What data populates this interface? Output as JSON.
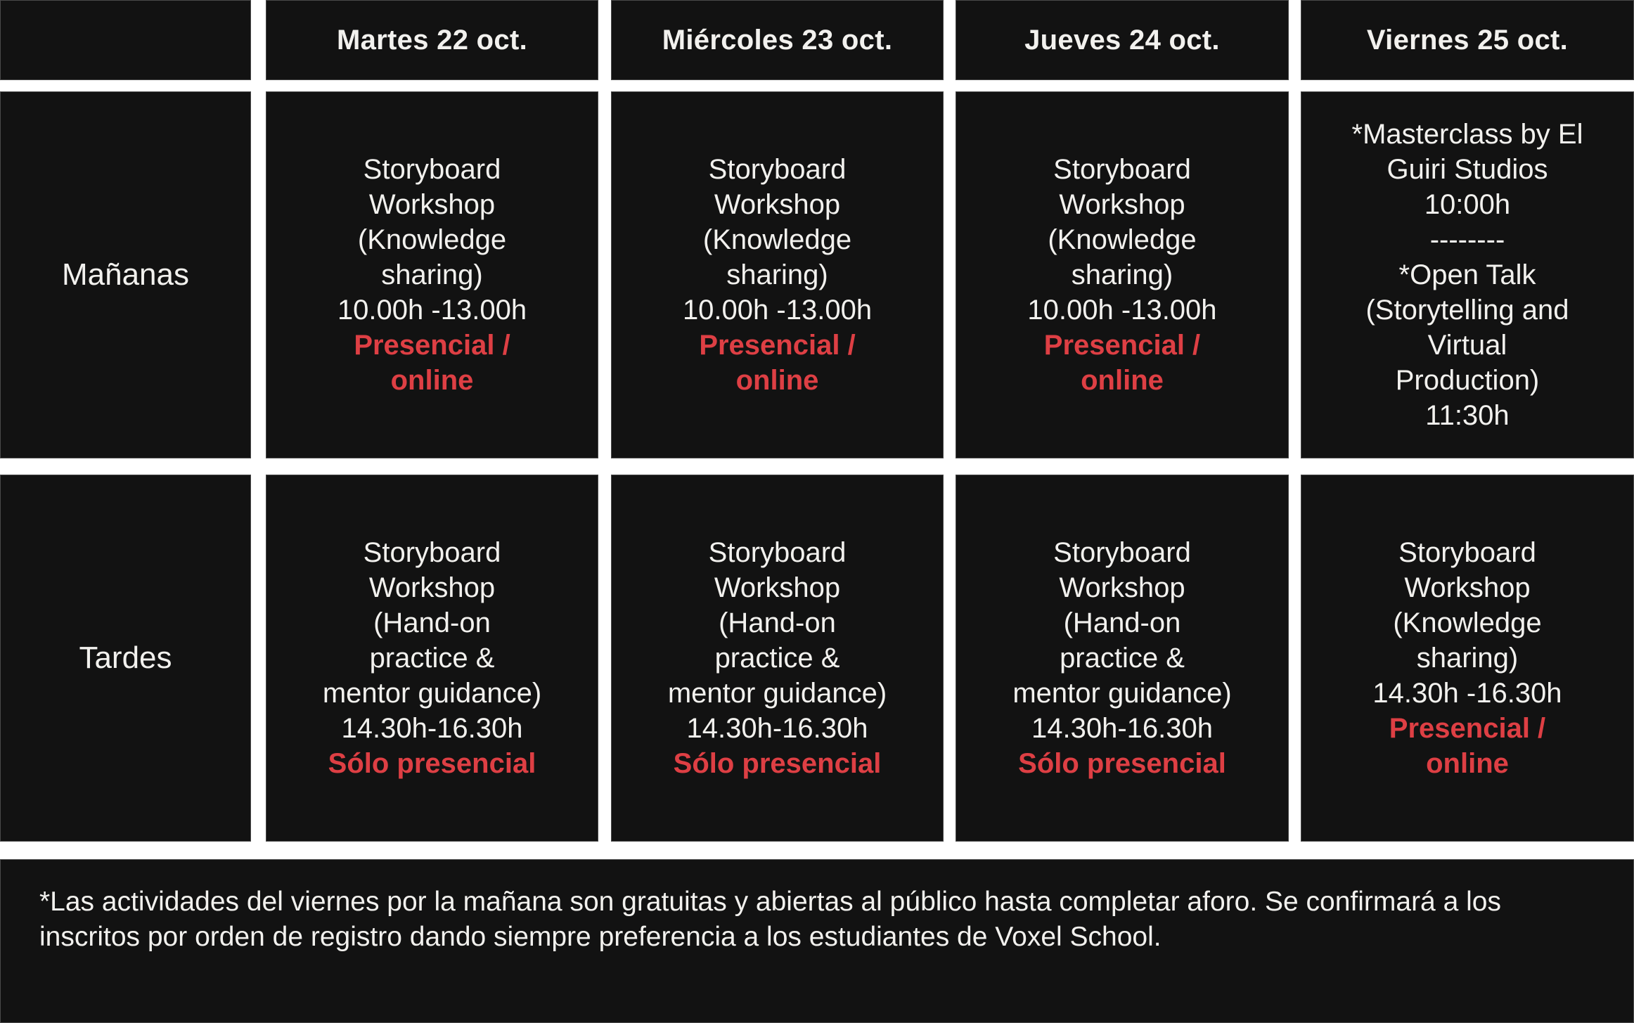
{
  "colors": {
    "cell_bg": "#121212",
    "accent_red": "#de3f44",
    "text": "#f2f1ee",
    "background": "#ffffff"
  },
  "header": {
    "corner": "",
    "days": [
      "Martes 22 oct.",
      "Miércoles 23 oct.",
      "Jueves 24 oct.",
      "Viernes 25 oct."
    ]
  },
  "rows": [
    {
      "label": "Mañanas",
      "cells": [
        {
          "lines": [
            "Storyboard",
            "Workshop",
            "(Knowledge",
            "sharing)",
            "10.00h -13.00h"
          ],
          "mode": [
            "Presencial /",
            "online"
          ]
        },
        {
          "lines": [
            "Storyboard",
            "Workshop",
            "(Knowledge",
            "sharing)",
            "10.00h -13.00h"
          ],
          "mode": [
            "Presencial /",
            "online"
          ]
        },
        {
          "lines": [
            "Storyboard",
            "Workshop",
            "(Knowledge",
            "sharing)",
            "10.00h -13.00h"
          ],
          "mode": [
            "Presencial /",
            "online"
          ]
        },
        {
          "lines": [
            "*Masterclass by El",
            "Guiri Studios",
            "10:00h",
            "--------",
            "*Open Talk",
            "(Storytelling and",
            "Virtual",
            "Production)",
            "11:30h"
          ],
          "mode": []
        }
      ]
    },
    {
      "label": "Tardes",
      "cells": [
        {
          "lines": [
            "Storyboard",
            "Workshop",
            "(Hand-on",
            "practice &",
            "mentor guidance)",
            "14.30h-16.30h"
          ],
          "mode": [
            "Sólo presencial"
          ]
        },
        {
          "lines": [
            "Storyboard",
            "Workshop",
            "(Hand-on",
            "practice &",
            "mentor guidance)",
            "14.30h-16.30h"
          ],
          "mode": [
            "Sólo presencial"
          ]
        },
        {
          "lines": [
            "Storyboard",
            "Workshop",
            "(Hand-on",
            "practice &",
            "mentor guidance)",
            "14.30h-16.30h"
          ],
          "mode": [
            "Sólo presencial"
          ]
        },
        {
          "lines": [
            "Storyboard",
            "Workshop",
            "(Knowledge",
            "sharing)",
            "14.30h -16.30h"
          ],
          "mode": [
            "Presencial /",
            "online"
          ]
        }
      ]
    }
  ],
  "footer": {
    "note": "*Las actividades del viernes por la mañana son gratuitas y abiertas al público hasta completar aforo. Se confirmará a los inscritos por orden de registro dando siempre preferencia a los estudiantes de Voxel School."
  }
}
